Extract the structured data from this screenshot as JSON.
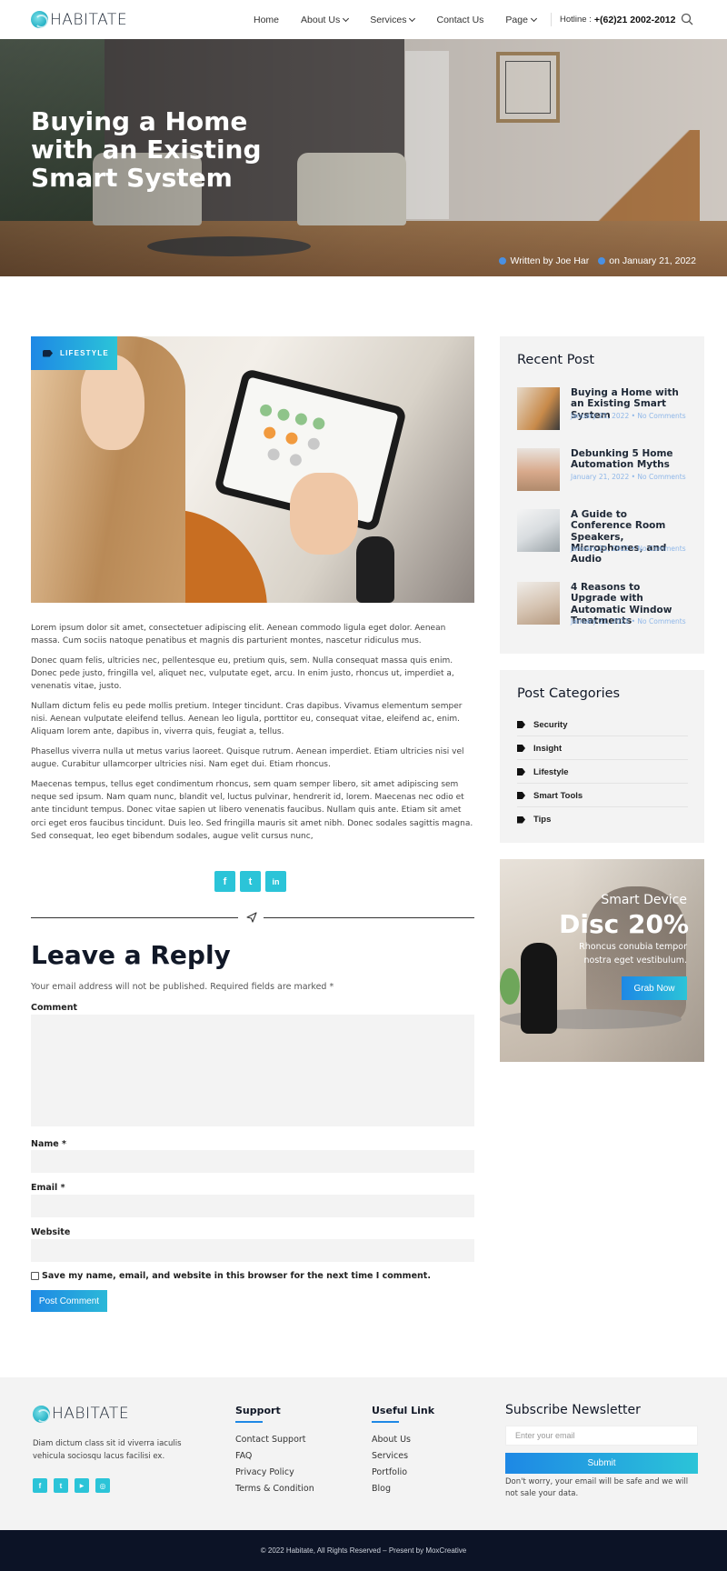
{
  "header": {
    "logo_text": "HABITATE",
    "nav": [
      {
        "label": "Home",
        "has_dropdown": false
      },
      {
        "label": "About Us",
        "has_dropdown": true
      },
      {
        "label": "Services",
        "has_dropdown": true
      },
      {
        "label": "Contact Us",
        "has_dropdown": false
      },
      {
        "label": "Page",
        "has_dropdown": true
      }
    ],
    "hotline_label": "Hotline :",
    "hotline_number": "+(62)21 2002-2012",
    "search_icon": "search-icon"
  },
  "hero": {
    "title": "Buying a Home with an Existing Smart System",
    "author": "Written by Joe Har",
    "date": "on January 21, 2022"
  },
  "post": {
    "category_tag": "LIFESTYLE",
    "paragraphs": [
      "Lorem ipsum dolor sit amet, consectetuer adipiscing elit. Aenean commodo ligula eget dolor. Aenean massa. Cum sociis natoque penatibus et magnis dis parturient montes, nascetur ridiculus mus.",
      "Donec quam felis, ultricies nec, pellentesque eu, pretium quis, sem. Nulla consequat massa quis enim. Donec pede justo, fringilla vel, aliquet nec, vulputate eget, arcu. In enim justo, rhoncus ut, imperdiet a, venenatis vitae, justo.",
      "Nullam dictum felis eu pede mollis pretium. Integer tincidunt. Cras dapibus. Vivamus elementum semper nisi. Aenean vulputate eleifend tellus. Aenean leo ligula, porttitor eu, consequat vitae, eleifend ac, enim. Aliquam lorem ante, dapibus in, viverra quis, feugiat a, tellus.",
      "Phasellus viverra nulla ut metus varius laoreet. Quisque rutrum. Aenean imperdiet. Etiam ultricies nisi vel augue. Curabitur ullamcorper ultricies nisi. Nam eget dui. Etiam rhoncus.",
      "Maecenas tempus, tellus eget condimentum rhoncus, sem quam semper libero, sit amet adipiscing sem neque sed ipsum. Nam quam nunc, blandit vel, luctus pulvinar, hendrerit id, lorem. Maecenas nec odio et ante tincidunt tempus. Donec vitae sapien ut libero venenatis faucibus. Nullam quis ante. Etiam sit amet orci eget eros faucibus tincidunt. Duis leo. Sed fringilla mauris sit amet nibh. Donec sodales sagittis magna. Sed consequat, leo eget bibendum sodales, augue velit cursus nunc,"
    ],
    "share": [
      {
        "icon": "facebook-icon",
        "glyph": "f"
      },
      {
        "icon": "twitter-icon",
        "glyph": "t"
      },
      {
        "icon": "linkedin-icon",
        "glyph": "in"
      }
    ]
  },
  "reply": {
    "title": "Leave a Reply",
    "note": "Your email address will not be published. Required fields are marked *",
    "comment_label": "Comment",
    "name_label": "Name *",
    "email_label": "Email *",
    "website_label": "Website",
    "remember_label": "Save my name, email, and website in this browser for the next time I comment.",
    "submit_label": "Post Comment"
  },
  "sidebar": {
    "recent_title": "Recent Post",
    "recent_posts": [
      {
        "title": "Buying a Home with an Existing Smart System",
        "meta": "January 21, 2022 • No Comments"
      },
      {
        "title": "Debunking 5 Home Automation Myths",
        "meta": "January 21, 2022 • No Comments"
      },
      {
        "title": "A Guide to Conference Room Speakers, Microphones, and Audio",
        "meta": "January 21, 2022 • No Comments"
      },
      {
        "title": "4 Reasons to Upgrade with Automatic Window Treatments",
        "meta": "January 21, 2022 • No Comments"
      }
    ],
    "categories_title": "Post Categories",
    "categories": [
      "Security",
      "Insight",
      "Lifestyle",
      "Smart Tools",
      "Tips"
    ],
    "promo": {
      "subtitle": "Smart Device",
      "discount": "Disc 20%",
      "description": "Rhoncus conubia tempor nostra eget vestibulum.",
      "button": "Grab Now"
    }
  },
  "footer": {
    "logo_text": "HABITATE",
    "description": "Diam dictum class sit id viverra iaculis vehicula sociosqu lacus facilisi ex.",
    "social": [
      {
        "icon": "facebook-icon",
        "glyph": "f"
      },
      {
        "icon": "twitter-icon",
        "glyph": "t"
      },
      {
        "icon": "youtube-icon",
        "glyph": "▶"
      },
      {
        "icon": "instagram-icon",
        "glyph": "◎"
      }
    ],
    "support_title": "Support",
    "support_links": [
      "Contact Support",
      "FAQ",
      "Privacy Policy",
      "Terms & Condition"
    ],
    "useful_title": "Useful Link",
    "useful_links": [
      "About Us",
      "Services",
      "Portfolio",
      "Blog"
    ],
    "newsletter_title": "Subscribe Newsletter",
    "newsletter_placeholder": "Enter your email",
    "newsletter_button": "Submit",
    "newsletter_note": "Don't worry, your email will be safe and we will not sale your data.",
    "copyright": "© 2022 Habitate, All Rights Reserved – Present by MoxCreative"
  },
  "colors": {
    "accent_gradient_start": "#1e88e5",
    "accent_gradient_end": "#2bc4d8",
    "meta_blue": "#8fb7e8",
    "footer_bar": "#0c1326"
  }
}
